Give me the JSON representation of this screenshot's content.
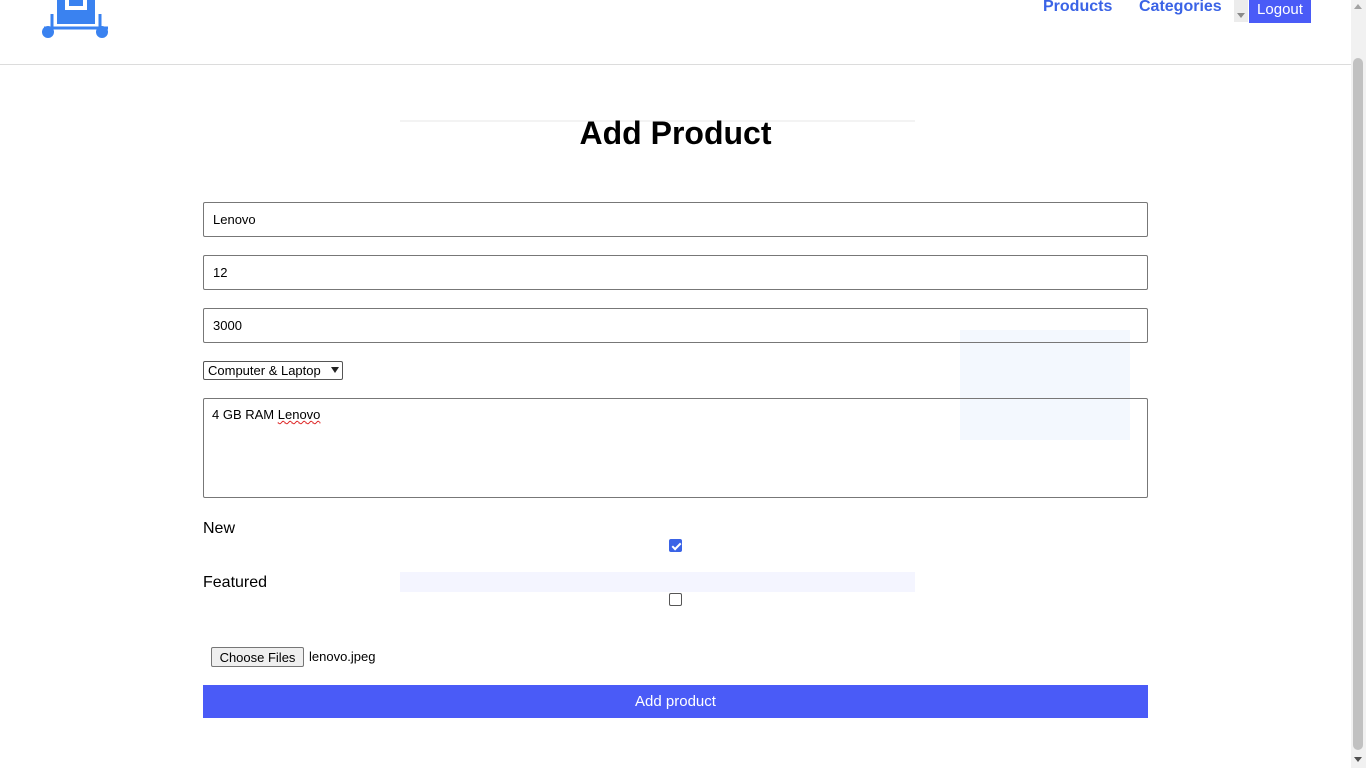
{
  "header": {
    "nav": {
      "products": "Products",
      "categories": "Categories"
    },
    "logout_label": "Logout",
    "logo_icon": "cart-icon"
  },
  "form": {
    "title": "Add Product",
    "name_value": "Lenovo",
    "quantity_value": "12",
    "price_value": "3000",
    "category_selected": "Computer & Laptop",
    "description_word1": "4 GB RAM ",
    "description_word2": "Lenovo",
    "new_label": "New",
    "new_checked": true,
    "featured_label": "Featured",
    "featured_checked": false,
    "file_button_label": "Choose Files",
    "file_name": "lenovo.jpeg",
    "submit_label": "Add product"
  },
  "colors": {
    "accent": "#4a5bf7",
    "link": "#3a63e6"
  }
}
